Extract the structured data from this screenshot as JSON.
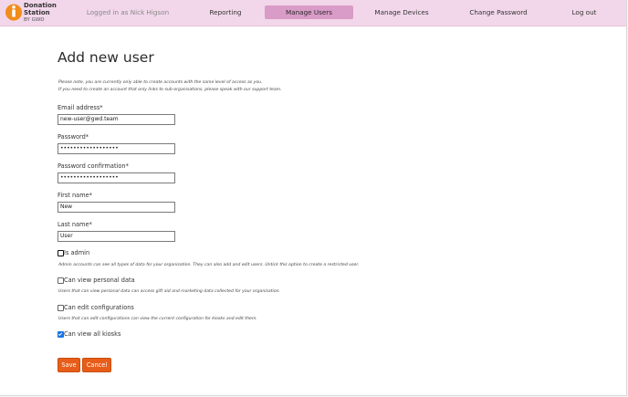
{
  "header": {
    "logo": {
      "line1": "Donation",
      "line2": "Station",
      "line3": "BY GWD"
    },
    "logged_in": "Logged in as Nick Higson",
    "nav": {
      "reporting": "Reporting",
      "manage_users": "Manage Users",
      "manage_devices": "Manage Devices",
      "change_password": "Change Password",
      "log_out": "Log out"
    }
  },
  "page": {
    "title": "Add new user",
    "note_line1": "Please note, you are currently only able to create accounts with the same level of access as you.",
    "note_line2": "If you need to create an account that only links to sub-organisations, please speak with our support team."
  },
  "form": {
    "email": {
      "label": "Email address*",
      "value": "new-user@gwd.team"
    },
    "password": {
      "label": "Password*",
      "value": "••••••••••••••••••"
    },
    "password_confirmation": {
      "label": "Password confirmation*",
      "value": "••••••••••••••••••"
    },
    "first_name": {
      "label": "First name*",
      "value": "New"
    },
    "last_name": {
      "label": "Last name*",
      "value": "User"
    },
    "is_admin": {
      "label": "Is admin",
      "checked": false,
      "hint": "Admin accounts can see all types of data for your organisation. They can also add and edit users. Untick this option to create a restricted user."
    },
    "view_personal": {
      "label": "Can view personal data",
      "checked": false,
      "hint": "Users that can view personal data can access gift aid and marketing data collected for your organisation."
    },
    "edit_configurations": {
      "label": "Can edit configurations",
      "checked": false,
      "hint": "Users that can edit configurations can view the current configuration for kiosks and edit them."
    },
    "view_kiosks": {
      "label": "Can view all kiosks",
      "checked": true
    },
    "save_label": "Save",
    "cancel_label": "Cancel"
  },
  "colors": {
    "header_bg": "#f2d7ea",
    "nav_active": "#d99bc7",
    "accent": "#e85d19",
    "logo_orange": "#f28c1a"
  }
}
